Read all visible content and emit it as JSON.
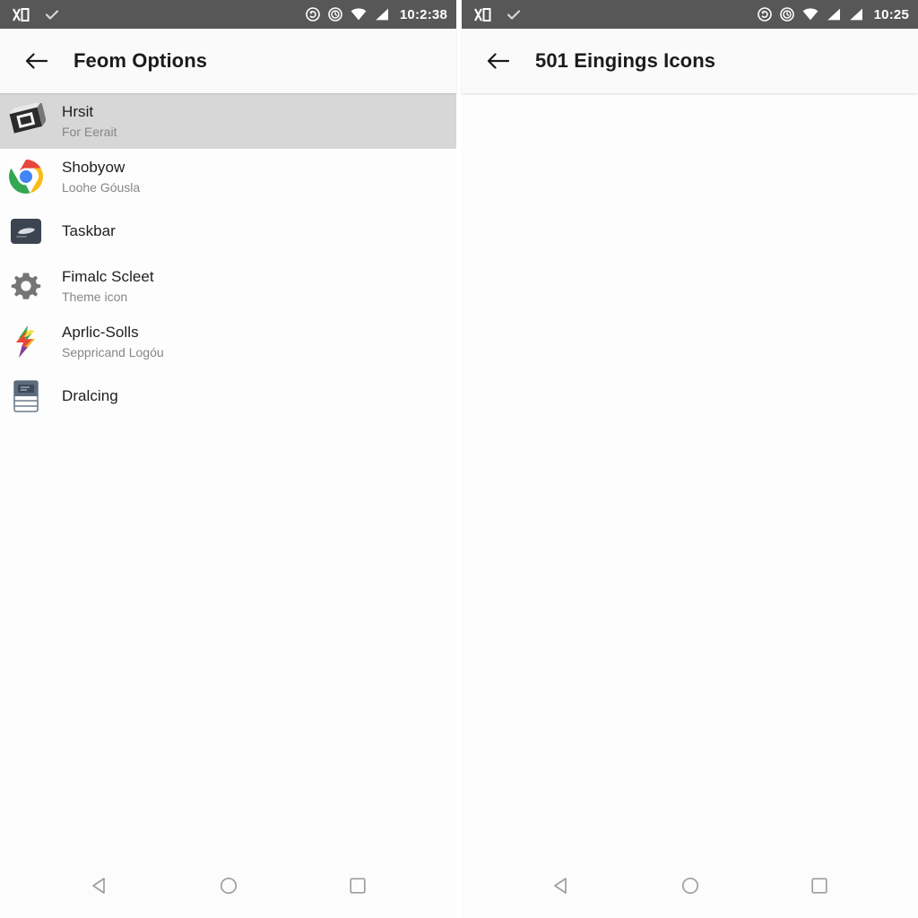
{
  "left": {
    "statusbar": {
      "left_icons": [
        "app-glyph-icon",
        "check-icon"
      ],
      "right_icons": [
        "alarm-circle-icon",
        "dnd-circle-icon",
        "wifi-icon",
        "signal-icon"
      ],
      "time": "10:2:38"
    },
    "appbar": {
      "back_icon": "back-arrow-icon",
      "title": "Feom Options"
    },
    "items": [
      {
        "icon": "dark-box-icon",
        "title": "Hrsit",
        "subtitle": "For Eerait",
        "selected": true
      },
      {
        "icon": "chrome-icon",
        "title": "Shobyow",
        "subtitle": "Loohe Góusla",
        "selected": false
      },
      {
        "icon": "taskbar-icon",
        "title": "Taskbar",
        "subtitle": "",
        "selected": false
      },
      {
        "icon": "gear-icon",
        "title": "Fimalc Scleet",
        "subtitle": "Theme icon",
        "selected": false
      },
      {
        "icon": "lightning-icon",
        "title": "Aprlic-Solls",
        "subtitle": "Seppricand Logóu",
        "selected": false
      },
      {
        "icon": "device-icon",
        "title": "Dralcing",
        "subtitle": "",
        "selected": false
      }
    ],
    "navbar": {
      "back": "nav-back-icon",
      "home": "nav-home-icon",
      "recents": "nav-recents-icon"
    }
  },
  "right": {
    "statusbar": {
      "left_icons": [
        "app-glyph-icon",
        "check-icon"
      ],
      "right_icons": [
        "alarm-circle-icon",
        "dnd-circle-icon",
        "wifi-icon",
        "signal-icon",
        "signal2-icon"
      ],
      "time": "10:25"
    },
    "appbar": {
      "back_icon": "back-arrow-icon",
      "title": "501 Eingings Icons"
    },
    "items": [],
    "navbar": {
      "back": "nav-back-icon",
      "home": "nav-home-icon",
      "recents": "nav-recents-icon"
    }
  },
  "colors": {
    "statusbar_bg": "#575757",
    "appbar_bg": "#fafafa",
    "selected_row": "#d7d7d7",
    "title_text": "#1e1e1e",
    "subtitle_text": "#868686",
    "nav_icon": "#9e9e9e"
  }
}
